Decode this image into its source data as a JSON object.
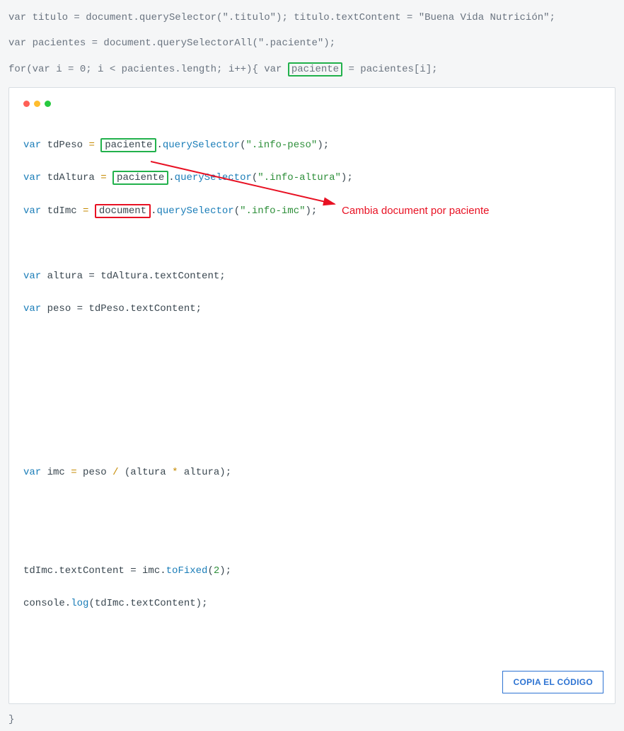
{
  "intro": {
    "line1_a": "var titulo = document.querySelector(\".titulo\"); titulo.textContent = \"Buena Vida Nutrición\";",
    "line2": "var pacientes = document.querySelectorAll(\".paciente\");",
    "line3_prefix": "for(var i = 0; i < pacientes.length; i++){ var ",
    "line3_boxed": "paciente",
    "line3_suffix": " = pacientes[i];"
  },
  "code": {
    "l1_kw": "var",
    "l1_id": " tdPeso ",
    "l1_op": "=",
    "l1_sp": " ",
    "l1_boxed": "paciente",
    "l1_after": ".",
    "l1_fn": "querySelector",
    "l1_paren_open": "(",
    "l1_str": "\".info-peso\"",
    "l1_paren_close": ");",
    "l2_kw": "var",
    "l2_id": " tdAltura ",
    "l2_op": "=",
    "l2_sp": " ",
    "l2_boxed": "paciente",
    "l2_after": ".",
    "l2_fn": "querySelector",
    "l2_paren_open": "(",
    "l2_str": "\".info-altura\"",
    "l2_paren_close": ");",
    "l3_kw": "var",
    "l3_id": " tdImc ",
    "l3_op": "=",
    "l3_sp": " ",
    "l3_boxed": "document",
    "l3_after": ".",
    "l3_fn": "querySelector",
    "l3_paren_open": "(",
    "l3_str": "\".info-imc\"",
    "l3_paren_close": ");",
    "l5_kw": "var",
    "l5_rest": " altura = tdAltura.textContent;",
    "l6_kw": "var",
    "l6_rest": " peso = tdPeso.textContent;",
    "l10_kw": "var",
    "l10_a": " imc ",
    "l10_op1": "=",
    "l10_b": " peso ",
    "l10_op2": "/",
    "l10_c": " (altura ",
    "l10_op3": "*",
    "l10_d": " altura);",
    "l13": "tdImc.textContent = imc.",
    "l13_fn": "toFixed",
    "l13_paren_open": "(",
    "l13_num": "2",
    "l13_paren_close": ");",
    "l14_a": "console.",
    "l14_fn": "log",
    "l14_rest": "(tdImc.textContent);"
  },
  "annotation_text": "Cambia document  por paciente",
  "copy_button": "COPIA EL CÓDIGO",
  "closing_brace": "}"
}
